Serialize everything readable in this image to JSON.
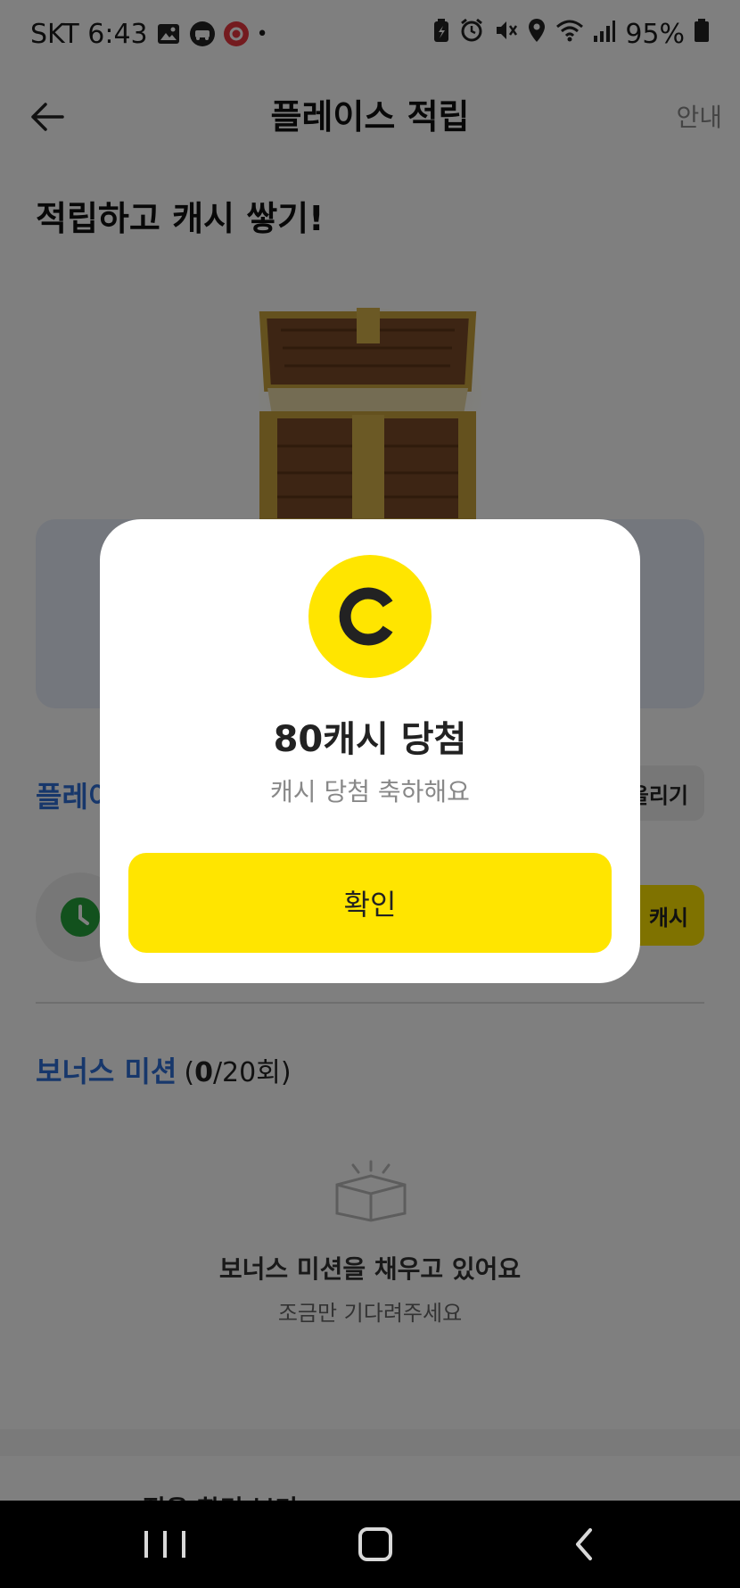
{
  "status_bar": {
    "carrier_time": "SKT 6:43",
    "dot": "•",
    "battery": "95%",
    "icons": [
      "image-icon",
      "car-icon",
      "app-badge-icon",
      "battery-saver-icon",
      "alarm-icon",
      "mute-icon",
      "location-icon",
      "wifi-icon",
      "signal-icon",
      "battery-icon"
    ]
  },
  "header": {
    "title": "플레이스 적립",
    "guide": "안내"
  },
  "hero": {
    "title": "적립하고 캐시 쌓기!"
  },
  "place_section": {
    "title": "플레이",
    "upload_label": "올리기",
    "cash_label": "캐시"
  },
  "bonus": {
    "title": "보너스 미션",
    "count_prefix": "(",
    "count_current": "0",
    "count_total": "/20회)",
    "empty_title": "보너스 미션을 채우고 있어요",
    "empty_sub": "조금만 기다려주세요"
  },
  "footer_peek": {
    "text": "적은 화면 보기"
  },
  "modal": {
    "coin_letter": "C",
    "title": "80캐시 당첨",
    "subtitle": "캐시 당첨 축하해요",
    "confirm": "확인"
  },
  "colors": {
    "accent_yellow": "#ffe500",
    "brand_blue": "#2f6fd6",
    "timer_green": "#24a33a"
  }
}
